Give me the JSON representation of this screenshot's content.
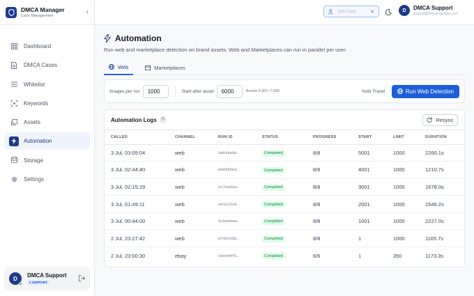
{
  "app": {
    "name": "DMCA Manager",
    "subtitle": "Case Management"
  },
  "sidebar": {
    "items": [
      {
        "label": "Dashboard",
        "icon": "dashboard-icon"
      },
      {
        "label": "DMCA Cases",
        "icon": "document-icon"
      },
      {
        "label": "Whitelist",
        "icon": "list-icon"
      },
      {
        "label": "Keywords",
        "icon": "scan-icon"
      },
      {
        "label": "Assets",
        "icon": "images-icon"
      },
      {
        "label": "Automation",
        "icon": "bolt-icon",
        "active": true
      },
      {
        "label": "Storage",
        "icon": "database-icon"
      },
      {
        "label": "Settings",
        "icon": "gear-icon"
      }
    ],
    "user": {
      "initial": "D",
      "name": "DMCA Support",
      "role": "SUPPORT"
    }
  },
  "topbar": {
    "selected_brand": "Nobi Travel",
    "user": {
      "initial": "D",
      "name": "DMCA Support",
      "email": "support@dmcamanager.com"
    }
  },
  "page": {
    "title": "Automation",
    "description": "Run web and marketplace detection on brand assets. Web and Marketplaces can run in parallel per user.",
    "tabs": [
      {
        "label": "Web",
        "active": true
      },
      {
        "label": "Marketplaces",
        "active": false
      }
    ]
  },
  "run_form": {
    "images_label": "Images per run",
    "images_value": "1000",
    "start_label": "Start after asset",
    "start_value": "6000",
    "range_text": "Assets 6,001–7,000",
    "brand": "Nobi Travel",
    "run_button": "Run Web Detection"
  },
  "logs": {
    "title": "Automation Logs",
    "help": "?",
    "resync_label": "Resync",
    "columns": [
      "CALLED",
      "CHANNEL",
      "RUN ID",
      "STATUS",
      "PROGRESS",
      "START",
      "LIMIT",
      "DURATION"
    ],
    "rows": [
      [
        "3 Jul, 03:05:04",
        "web",
        "3a818a9e…",
        "Completed",
        "8/8",
        "5001",
        "1000",
        "2260.1s"
      ],
      [
        "3 Jul, 02:44:40",
        "web",
        "e0e585e3…",
        "Completed",
        "8/8",
        "4001",
        "1000",
        "1210.7s"
      ],
      [
        "3 Jul, 02:15:29",
        "web",
        "e17eab1a…",
        "Completed",
        "8/8",
        "3001",
        "1000",
        "1678.0s"
      ],
      [
        "3 Jul, 01:49:11",
        "web",
        "e4161529…",
        "Completed",
        "8/8",
        "2001",
        "1000",
        "1546.2s"
      ],
      [
        "3 Jul, 00:44:00",
        "web",
        "5c8a04aa…",
        "Completed",
        "8/8",
        "1001",
        "1000",
        "2227.0s"
      ],
      [
        "2 Jul, 23:27:42",
        "web",
        "8746c65b…",
        "Completed",
        "8/8",
        "1",
        "1000",
        "1165.7s"
      ],
      [
        "2 Jul, 23:00:30",
        "ebay",
        "cbee44f5…",
        "Completed",
        "6/6",
        "1",
        "350",
        "1173.3s"
      ]
    ]
  },
  "colors": {
    "primary": "#1e3a8a",
    "button": "#1d5fd8",
    "success_bg": "#dcfce7",
    "success_text": "#15803d"
  }
}
